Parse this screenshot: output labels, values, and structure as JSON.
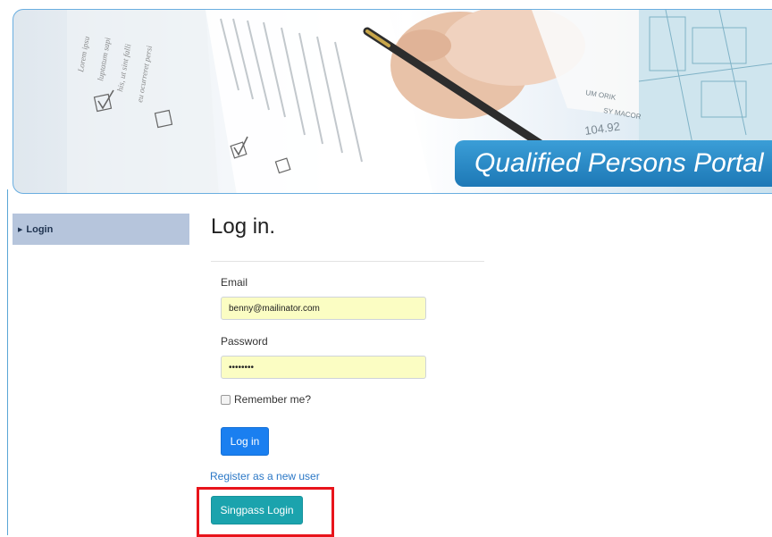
{
  "banner": {
    "title": "Qualified Persons Portal",
    "paper_text": [
      "Lorem ipsu",
      "luptatum sapi",
      "his, ut sint falli",
      "eu ocurreret persi"
    ],
    "plan_number": "104.92"
  },
  "sidebar": {
    "items": [
      {
        "label": "Login"
      }
    ]
  },
  "login": {
    "title": "Log in.",
    "email_label": "Email",
    "email_value": "benny@mailinator.com",
    "password_label": "Password",
    "password_value": "12345678",
    "remember_label": "Remember me?",
    "remember_checked": false,
    "login_button": "Log in",
    "register_link": "Register as a new user",
    "singpass_button": "Singpass Login"
  },
  "colors": {
    "banner_title_bg": "#2389c7",
    "sidebar_bg": "#b6c5dc",
    "input_bg": "#fbfdc3",
    "primary_button": "#1a7ff0",
    "singpass_button": "#1ba3ad",
    "link": "#2a77c6",
    "highlight": "#e8141b"
  }
}
